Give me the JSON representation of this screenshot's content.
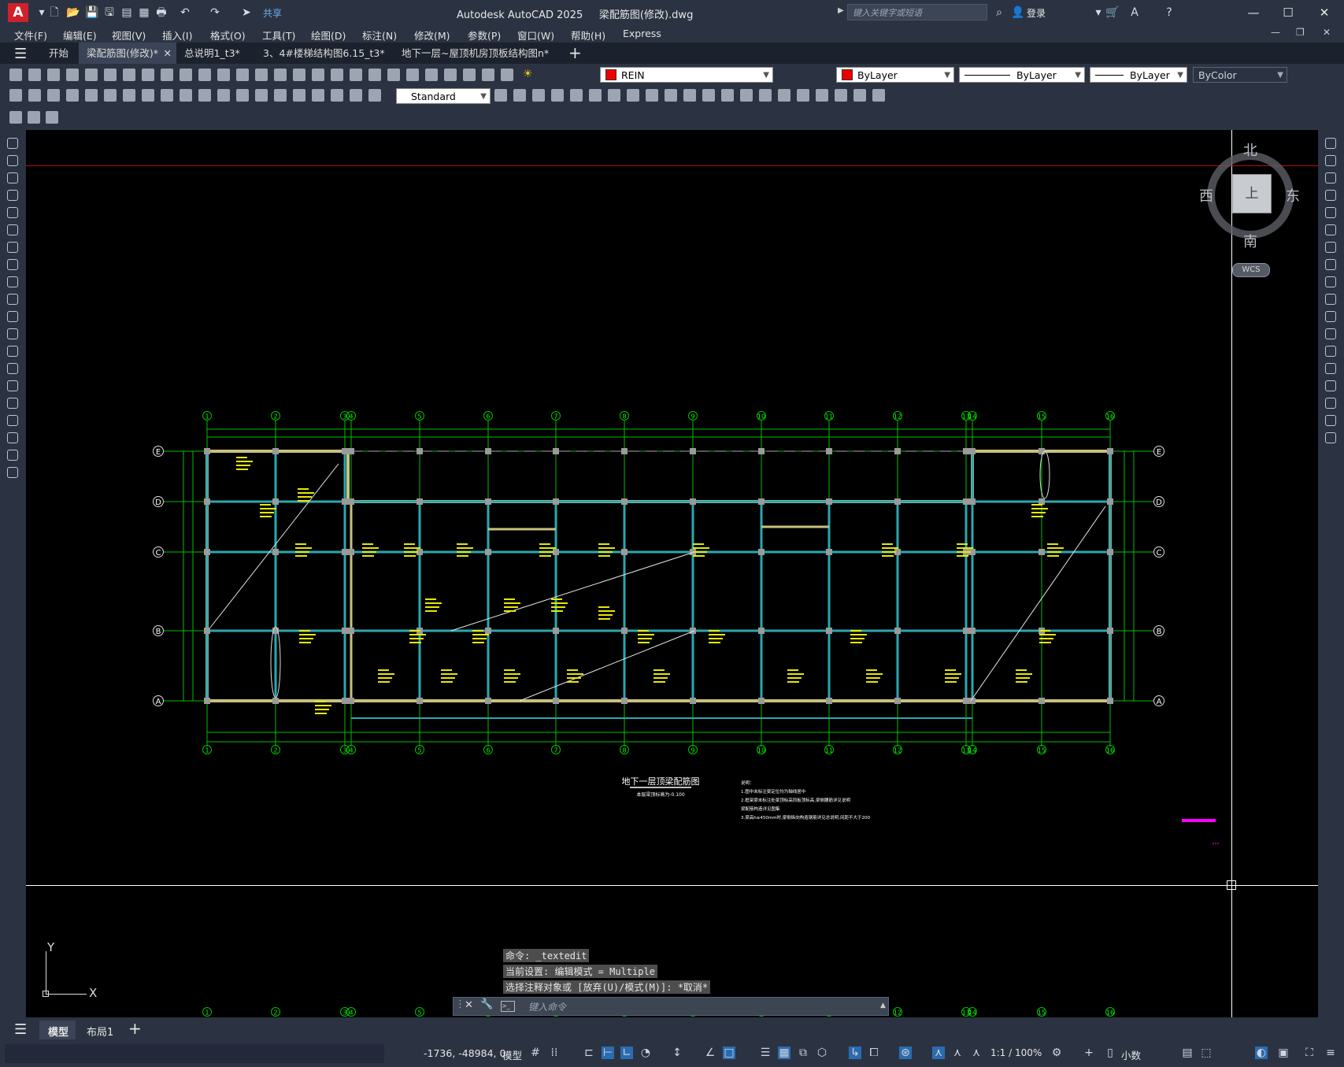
{
  "titlebar": {
    "app_icon": "A",
    "share": "共享",
    "title": "Autodesk AutoCAD 2025     梁配筋图(修改).dwg",
    "search_placeholder": "键入关键字或短语",
    "login": "登录"
  },
  "menu": [
    "文件(F)",
    "编辑(E)",
    "视图(V)",
    "插入(I)",
    "格式(O)",
    "工具(T)",
    "绘图(D)",
    "标注(N)",
    "修改(M)",
    "参数(P)",
    "窗口(W)",
    "帮助(H)",
    "Express"
  ],
  "file_tabs": [
    {
      "label": "开始",
      "active": false
    },
    {
      "label": "梁配筋图(修改)*",
      "active": true
    },
    {
      "label": "总说明1_t3*",
      "active": false
    },
    {
      "label": "3、4#楼梯结构图6.15_t3*",
      "active": false
    },
    {
      "label": "地下一层~屋顶机房顶板结构图n*",
      "active": false
    }
  ],
  "toolbar": {
    "layer": "REIN",
    "color": "ByLayer",
    "linetype": "ByLayer",
    "lineweight": "ByLayer",
    "plotstyle": "ByColor",
    "textstyle": "Standard"
  },
  "viewcube": {
    "north": "北",
    "south": "南",
    "east": "东",
    "west": "西",
    "top": "上",
    "wcs": "WCS"
  },
  "drawing": {
    "col_labels": [
      "1",
      "2",
      "3",
      "4",
      "5",
      "6",
      "7",
      "8",
      "9",
      "10",
      "11",
      "12",
      "13",
      "14",
      "15",
      "16"
    ],
    "row_labels": [
      "E",
      "D",
      "C",
      "B",
      "A"
    ],
    "title": "地下一层顶梁配筋图",
    "subtitle": "本层梁顶标高为-0.100",
    "notes": [
      "说明：",
      "1.图中未标注梁定位均为轴线居中",
      "2.框架梁未标注处梁顶标高同板顶标高,梁侧腰筋详见说明",
      "  梁配筋构造详见图集",
      "3.梁高h≥450mm时,梁侧纵向构造钢筋详见总说明,间距不大于200"
    ]
  },
  "command": {
    "history": [
      "命令: _textedit",
      "当前设置: 编辑模式 = Multiple",
      "选择注释对象或 [放弃(U)/模式(M)]: *取消*"
    ],
    "placeholder": "键入命令"
  },
  "layout_tabs": [
    "模型",
    "布局1"
  ],
  "status": {
    "coords": "-1736, -48984, 0",
    "model": "模型",
    "scale": "1:1 / 100%",
    "units": "小数"
  },
  "ucs": {
    "x": "X",
    "y": "Y"
  }
}
